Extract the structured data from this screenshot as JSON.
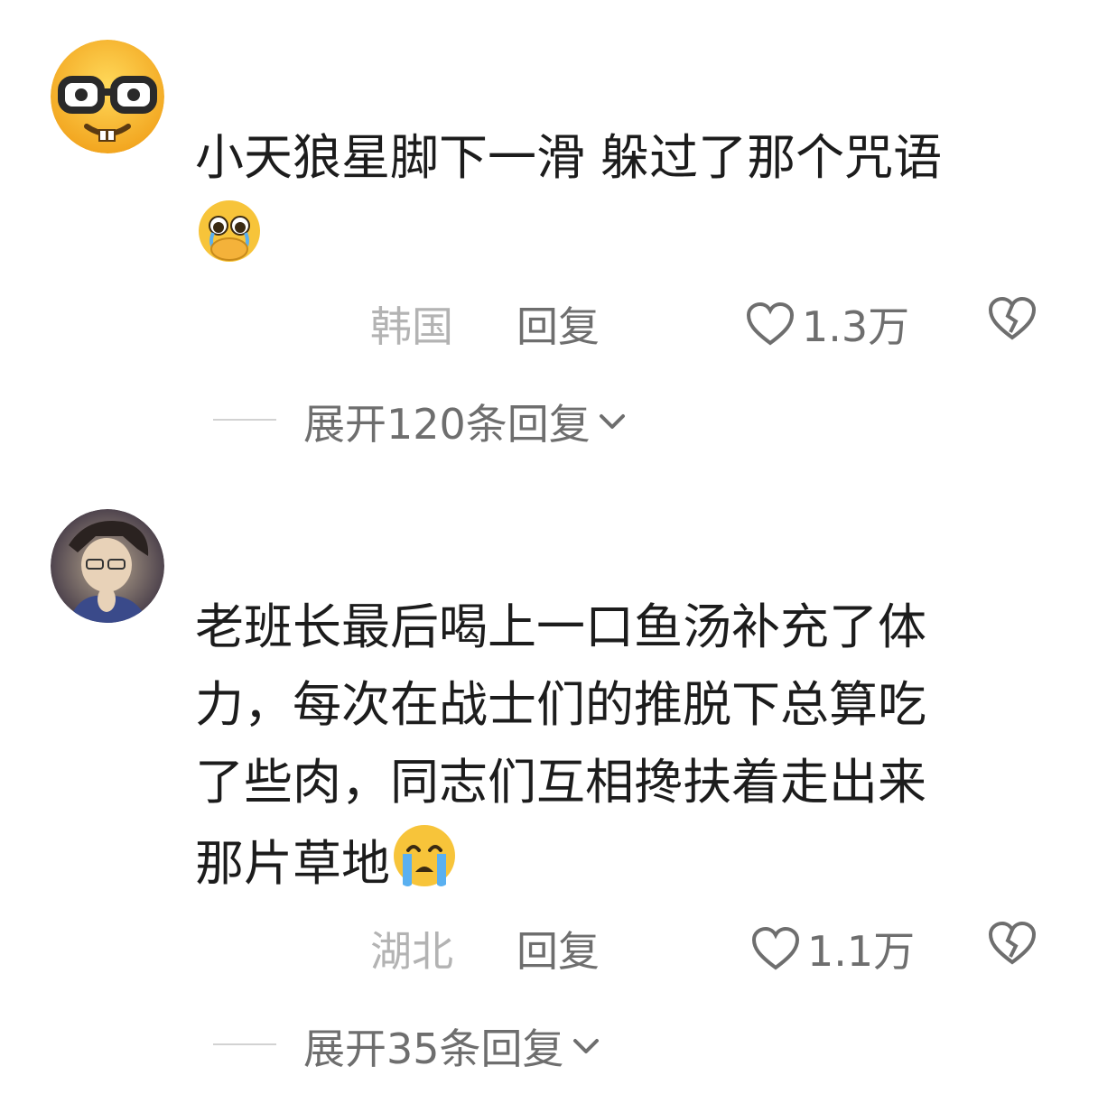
{
  "comments": [
    {
      "avatar": "nerd-face-emoji-avatar",
      "text": "小天狼星脚下一滑 躲过了那个咒语",
      "inline_emoji": "pleading-face-hand-over-mouth-emoji",
      "location": "韩国",
      "reply_label": "回复",
      "likes": "1.3万",
      "expand_label": "展开120条回复"
    },
    {
      "avatar": "anime-character-avatar",
      "text_lines": [
        "老班长最后喝上一口鱼汤补充了体",
        "力，每次在战士们的推脱下总算吃",
        "了些肉，同志们互相搀扶着走出来",
        "那片草地"
      ],
      "inline_emoji": "loudly-crying-face-emoji",
      "location": "湖北",
      "reply_label": "回复",
      "likes": "1.1万",
      "expand_label": "展开35条回复"
    }
  ],
  "icons": {
    "like": "heart-outline-icon",
    "dislike": "broken-heart-icon",
    "expand": "chevron-down-icon"
  },
  "colors": {
    "text": "#1c1c1c",
    "meta": "#6e6e6e",
    "location": "#b3b3b3",
    "emoji_yellow": "#f7c43a"
  }
}
